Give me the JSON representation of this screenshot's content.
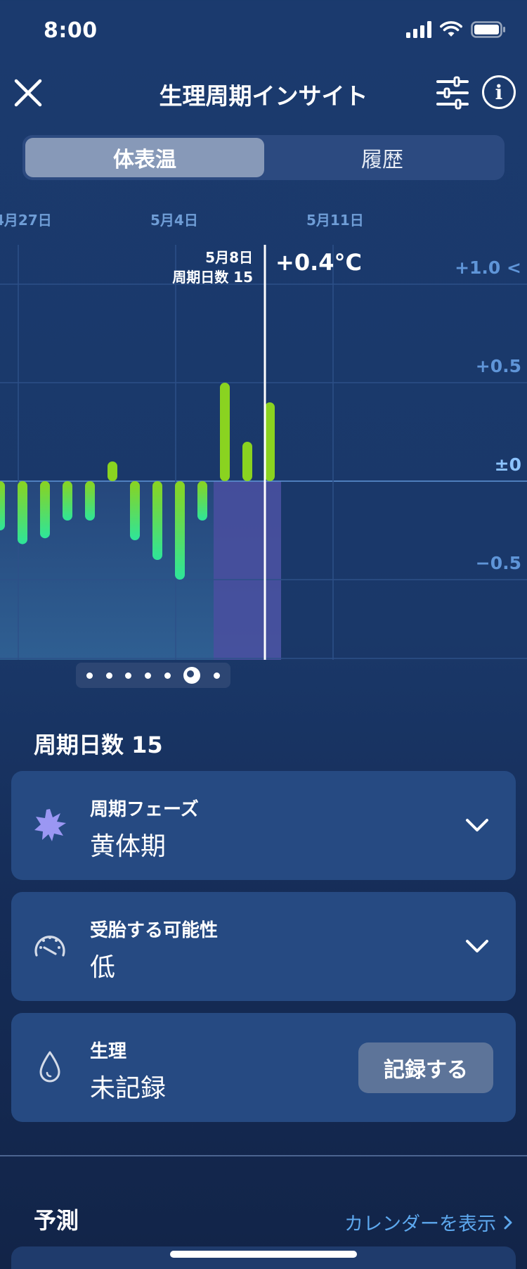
{
  "status_bar": {
    "time": "8:00"
  },
  "header": {
    "title": "生理周期インサイト"
  },
  "tabs": [
    {
      "label": "体表温",
      "active": true
    },
    {
      "label": "履歴",
      "active": false
    }
  ],
  "chart_data": {
    "type": "bar",
    "title": "",
    "xlabel": "",
    "ylabel": "",
    "x_tick_labels": [
      "4月27日",
      "5月4日",
      "5月11日"
    ],
    "y_tick_labels": [
      "+1.0",
      "+0.5",
      "±0",
      "−0.5"
    ],
    "ylim": [
      -0.9,
      1.1
    ],
    "grid": true,
    "series": [
      {
        "values": [
          -0.25,
          -0.32,
          -0.29,
          -0.2,
          -0.2,
          0.1,
          -0.3,
          -0.4,
          -0.5,
          -0.2,
          0.5,
          0.2,
          0.4
        ]
      }
    ],
    "selected": {
      "date": "5月8日",
      "cycle_day_label": "周期日数 15",
      "value": "+0.4°C"
    },
    "scroll_hint": "<"
  },
  "pager": {
    "count": 7,
    "active_index": 5
  },
  "cycle_section": {
    "title": "周期日数 15",
    "cards": [
      {
        "icon": "starburst-icon",
        "label": "周期フェーズ",
        "value": "黄体期"
      },
      {
        "icon": "gauge-icon",
        "label": "受胎する可能性",
        "value": "低"
      },
      {
        "icon": "drop-icon",
        "label": "生理",
        "value": "未記録",
        "action": "記録する"
      }
    ]
  },
  "forecast": {
    "title": "予測",
    "link": "カレンダーを表示"
  },
  "colors": {
    "background": "#1b3a6e",
    "accent": "#5da8ee",
    "bar_positive": "#8ad320",
    "bar_negative": "#2ee59a",
    "luteal_shade": "#4a4fa0"
  }
}
